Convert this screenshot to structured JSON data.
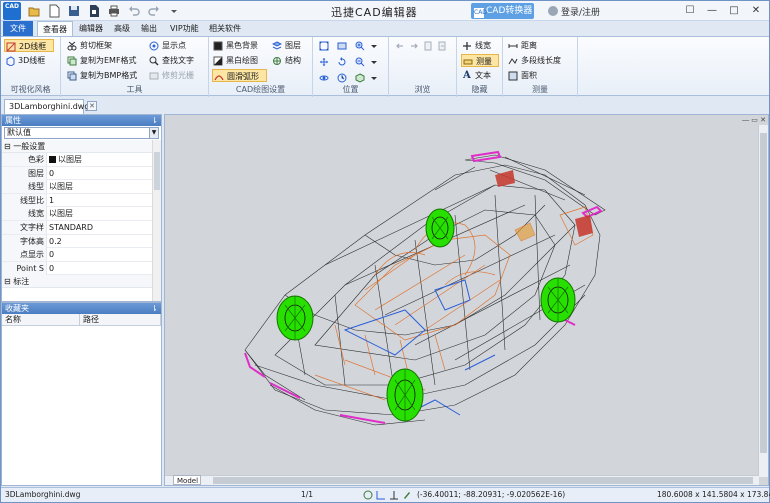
{
  "title_bar": {
    "logo_text": "CAD",
    "app_title": "迅捷CAD编辑器",
    "convert_button": "CAD转换器",
    "convert_icon": "CAD",
    "login": "登录/注册",
    "controls": [
      "☐",
      "—",
      "□",
      "✕"
    ]
  },
  "menu_tabs": [
    "文件",
    "查看器",
    "编辑器",
    "高级",
    "输出",
    "VIP功能",
    "相关软件"
  ],
  "ribbon": {
    "groups": {
      "visual_style": {
        "label": "可视化风格",
        "wireframe_2d": "2D线框",
        "wireframe_3d": "3D线框"
      },
      "tools": {
        "label": "工具",
        "clip_frame": "剪切框架",
        "copy_emf": "复制为EMF格式",
        "copy_bmp": "复制为BMP格式",
        "show_points": "显示点",
        "find_text": "查找文字",
        "trim_raster": "修剪光栅"
      },
      "cad_settings": {
        "label": "CAD绘图设置",
        "black_bg": "黑色背景",
        "bw_drawing": "黑白绘图",
        "smooth_arc": "圆滑弧形",
        "layers": "图层",
        "structure": "结构"
      },
      "position": {
        "label": "位置"
      },
      "browse": {
        "label": "浏览"
      },
      "hide": {
        "label": "隐藏",
        "line_width": "线宽",
        "measure": "测量",
        "text": "文本"
      },
      "measure": {
        "label": "测量",
        "distance": "距离",
        "polyline_length": "多段线长度",
        "area": "面积"
      }
    }
  },
  "document": {
    "tab_name": "3DLamborghini.dwg",
    "close": "✕"
  },
  "properties_panel": {
    "title": "属性",
    "pin": "⇂",
    "selector_value": "默认值",
    "section_general": "一般设置",
    "section_general_toggle": "⊟",
    "rows": [
      {
        "key": "色彩",
        "value": "以图层"
      },
      {
        "key": "图层",
        "value": "0"
      },
      {
        "key": "线型",
        "value": "以图层"
      },
      {
        "key": "线型比",
        "value": "1"
      },
      {
        "key": "线宽",
        "value": "以图层"
      },
      {
        "key": "文字样",
        "value": "STANDARD"
      },
      {
        "key": "字体高",
        "value": "0.2"
      },
      {
        "key": "点显示",
        "value": "0"
      },
      {
        "key": "Point S",
        "value": "0"
      }
    ],
    "section_annotation": "标注",
    "section_annotation_toggle": "⊟"
  },
  "favorites_panel": {
    "title": "收藏夹",
    "pin": "⇂",
    "columns": [
      "名称",
      "路径"
    ]
  },
  "canvas": {
    "background": "#d2d6db",
    "model_tab": "Model",
    "corner_controls": "― ▭ ✕"
  },
  "status_bar": {
    "file": "3DLamborghini.dwg",
    "page": "1/1",
    "coordinates": "(-36.40011; -88.20931; -9.020562E-16)",
    "dimensions": "180.6008 x 141.5804 x 173.8424"
  },
  "colors": {
    "accent": "#2a6fce",
    "wheel": "#22e000",
    "pink": "#e02cc8",
    "orange": "#e06a20",
    "blue": "#2b5fd8"
  }
}
